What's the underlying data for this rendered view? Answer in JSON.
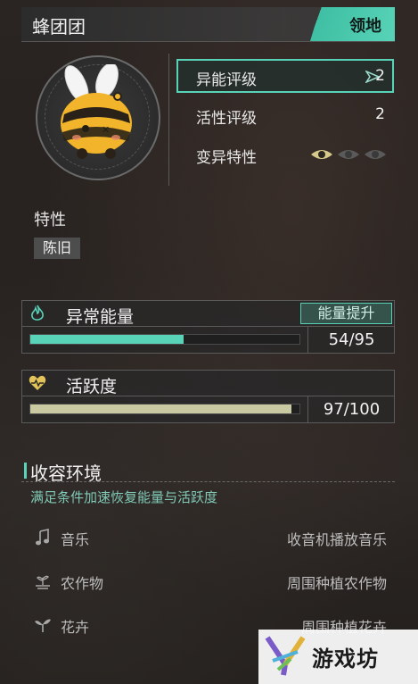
{
  "header": {
    "title": "蜂团团",
    "tag": "领地"
  },
  "ratings": [
    {
      "label": "异能评级",
      "value": "2",
      "selected": true
    },
    {
      "label": "活性评级",
      "value": "2",
      "selected": false
    },
    {
      "label": "变异特性",
      "eyes_active": 1,
      "eyes_total": 3
    }
  ],
  "traits": {
    "title": "特性",
    "items": [
      "陈旧"
    ]
  },
  "energy": {
    "title": "异常能量",
    "button_label": "能量提升",
    "current": 54,
    "max": 95,
    "text": "54/95",
    "color": "#58d3b8"
  },
  "activity": {
    "title": "活跃度",
    "current": 97,
    "max": 100,
    "text": "97/100",
    "color": "#c9c9a2"
  },
  "containment": {
    "title": "收容环境",
    "subtitle": "满足条件加速恢复能量与活跃度",
    "conditions": [
      {
        "icon": "music-note-icon",
        "label": "音乐",
        "desc": "收音机播放音乐"
      },
      {
        "icon": "crop-icon",
        "label": "农作物",
        "desc": "周围种植农作物"
      },
      {
        "icon": "sprout-icon",
        "label": "花卉",
        "desc": "周围种植花卉"
      }
    ]
  },
  "watermark": {
    "text": "游戏坊"
  },
  "colors": {
    "accent": "#58d3b8",
    "panel_border": "#5b5b5b"
  }
}
